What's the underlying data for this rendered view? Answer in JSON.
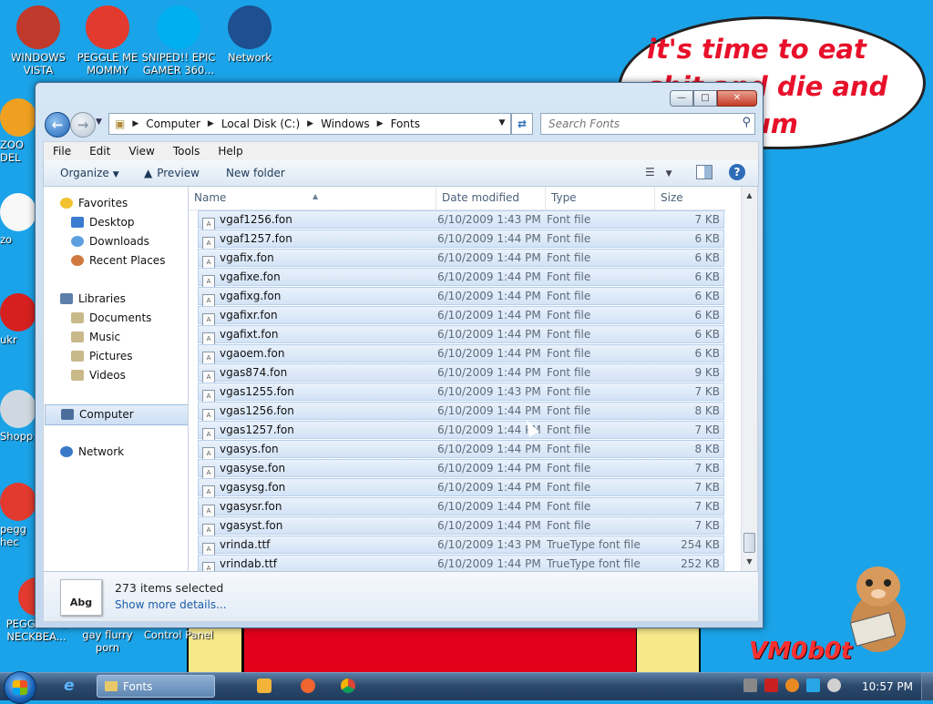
{
  "desktop": {
    "icons": [
      {
        "label": "WINDOWS VISTA",
        "color": "#c0392b"
      },
      {
        "label": "PEGGLE ME MOMMY",
        "color": "#e23a2e"
      },
      {
        "label": "SNIPED!! EPIC GAMER 360...",
        "color": "#00aff0"
      },
      {
        "label": "Network",
        "color": "#1d4f91"
      }
    ],
    "edge_icons": [
      {
        "label": "ZOO DEL",
        "color": "#f0a020"
      },
      {
        "label": "zo",
        "color": "#f8f8f8"
      },
      {
        "label": "ukr",
        "color": "#d62020"
      },
      {
        "label": "Shopp",
        "color": "#cfd8e0"
      },
      {
        "label": "pegg hec",
        "color": "#e23a2e"
      },
      {
        "label": "PEGGLE ME NECKBEA...",
        "color": "#e23a2e"
      }
    ],
    "bottom_labels": [
      "gay flurry porn",
      "Control Panel"
    ],
    "bubble_text": "it's time to eat shit and die and chew gum",
    "watermark": "VM0b0t"
  },
  "window": {
    "caption_buttons": {
      "minimize": "—",
      "maximize": "□",
      "close": "✕"
    },
    "breadcrumb": [
      "Computer",
      "Local Disk (C:)",
      "Windows",
      "Fonts"
    ],
    "search_placeholder": "Search Fonts",
    "menu": [
      "File",
      "Edit",
      "View",
      "Tools",
      "Help"
    ],
    "commands": {
      "organize": "Organize",
      "preview": "Preview",
      "new_folder": "New folder",
      "help": "?"
    },
    "nav": {
      "favorites": "Favorites",
      "desktop": "Desktop",
      "downloads": "Downloads",
      "recent": "Recent Places",
      "libraries": "Libraries",
      "documents": "Documents",
      "music": "Music",
      "pictures": "Pictures",
      "videos": "Videos",
      "computer": "Computer",
      "network": "Network"
    },
    "columns": {
      "name": "Name",
      "date": "Date modified",
      "type": "Type",
      "size": "Size"
    },
    "files": [
      {
        "name": "vgaf1256.fon",
        "date": "6/10/2009 1:43 PM",
        "type": "Font file",
        "size": "7 KB"
      },
      {
        "name": "vgaf1257.fon",
        "date": "6/10/2009 1:44 PM",
        "type": "Font file",
        "size": "6 KB"
      },
      {
        "name": "vgafix.fon",
        "date": "6/10/2009 1:44 PM",
        "type": "Font file",
        "size": "6 KB"
      },
      {
        "name": "vgafixe.fon",
        "date": "6/10/2009 1:44 PM",
        "type": "Font file",
        "size": "6 KB"
      },
      {
        "name": "vgafixg.fon",
        "date": "6/10/2009 1:44 PM",
        "type": "Font file",
        "size": "6 KB"
      },
      {
        "name": "vgafixr.fon",
        "date": "6/10/2009 1:44 PM",
        "type": "Font file",
        "size": "6 KB"
      },
      {
        "name": "vgafixt.fon",
        "date": "6/10/2009 1:44 PM",
        "type": "Font file",
        "size": "6 KB"
      },
      {
        "name": "vgaoem.fon",
        "date": "6/10/2009 1:44 PM",
        "type": "Font file",
        "size": "6 KB"
      },
      {
        "name": "vgas874.fon",
        "date": "6/10/2009 1:44 PM",
        "type": "Font file",
        "size": "9 KB"
      },
      {
        "name": "vgas1255.fon",
        "date": "6/10/2009 1:43 PM",
        "type": "Font file",
        "size": "7 KB"
      },
      {
        "name": "vgas1256.fon",
        "date": "6/10/2009 1:44 PM",
        "type": "Font file",
        "size": "8 KB"
      },
      {
        "name": "vgas1257.fon",
        "date": "6/10/2009 1:44 PM",
        "type": "Font file",
        "size": "7 KB"
      },
      {
        "name": "vgasys.fon",
        "date": "6/10/2009 1:44 PM",
        "type": "Font file",
        "size": "8 KB"
      },
      {
        "name": "vgasyse.fon",
        "date": "6/10/2009 1:44 PM",
        "type": "Font file",
        "size": "7 KB"
      },
      {
        "name": "vgasysg.fon",
        "date": "6/10/2009 1:44 PM",
        "type": "Font file",
        "size": "7 KB"
      },
      {
        "name": "vgasysr.fon",
        "date": "6/10/2009 1:44 PM",
        "type": "Font file",
        "size": "7 KB"
      },
      {
        "name": "vgasyst.fon",
        "date": "6/10/2009 1:44 PM",
        "type": "Font file",
        "size": "7 KB"
      },
      {
        "name": "vrinda.ttf",
        "date": "6/10/2009 1:43 PM",
        "type": "TrueType font file",
        "size": "254 KB"
      },
      {
        "name": "vrindab.ttf",
        "date": "6/10/2009 1:44 PM",
        "type": "TrueType font file",
        "size": "252 KB"
      }
    ],
    "details": {
      "preview_text": "Abg",
      "selection": "273 items selected",
      "more": "Show more details..."
    }
  },
  "taskbar": {
    "ie_glyph": "e",
    "active_window": "Fonts",
    "clock": "10:57 PM"
  },
  "colors": {
    "desktop": "#1aa3e8",
    "selection": "#d3e3f6",
    "link": "#1c5ea8"
  }
}
